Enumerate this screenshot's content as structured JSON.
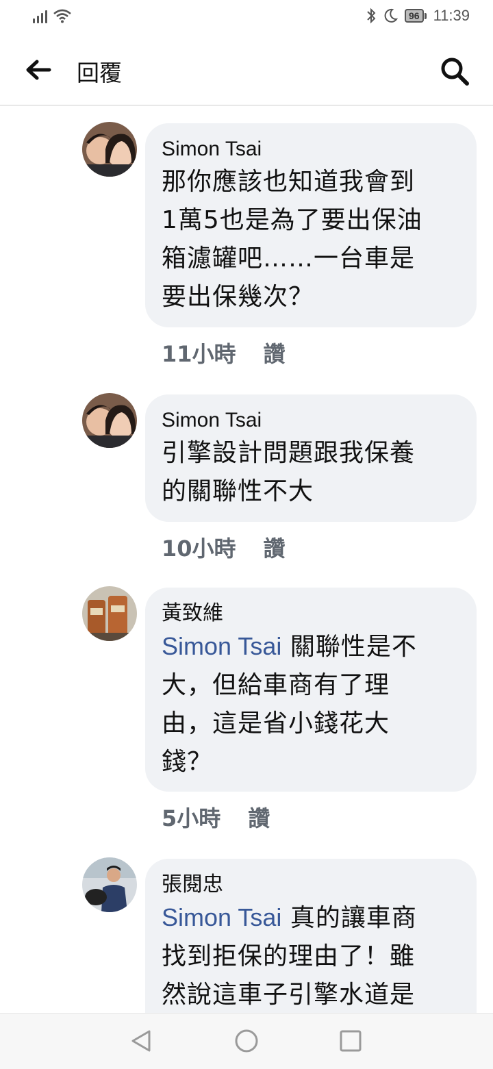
{
  "status_bar": {
    "time": "11:39",
    "battery": "96"
  },
  "header": {
    "title": "回覆"
  },
  "comments": [
    {
      "author": "Simon Tsai",
      "mention": "",
      "text_lines": [
        "那你應該也知道我會到",
        "1萬5也是為了要出保油",
        "箱濾罐吧……一台車是",
        "要出保幾次？"
      ],
      "time": "11小時",
      "like_label": "讚"
    },
    {
      "author": "Simon Tsai",
      "mention": "",
      "text_lines": [
        "引擎設計問題跟我保養",
        "的關聯性不大"
      ],
      "time": "10小時",
      "like_label": "讚"
    },
    {
      "author": "黃致維",
      "mention": "Simon Tsai",
      "first_line_rest": " 關聯性是不",
      "text_lines": [
        "大，但給車商有了理",
        "由，這是省小錢花大",
        "錢？"
      ],
      "time": "5小時",
      "like_label": "讚"
    },
    {
      "author": "張閱忠",
      "mention": "Simon Tsai",
      "first_line_rest": " 真的讓車商",
      "text_lines": [
        "找到拒保的理由了！雖",
        "然說這車子引擎水道是"
      ],
      "time": "",
      "like_label": ""
    }
  ],
  "icons": {
    "back": "arrow-left-icon",
    "search": "search-icon",
    "nav_back": "triangle-back-icon",
    "nav_home": "circle-home-icon",
    "nav_recent": "square-recent-icon"
  }
}
